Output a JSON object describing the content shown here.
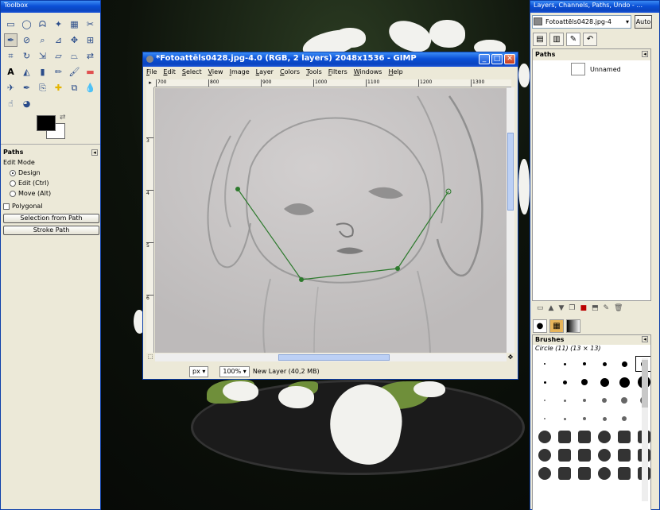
{
  "toolbox": {
    "title": "Toolbox",
    "tool_icons": [
      "rect-select-icon",
      "ellipse-select-icon",
      "lasso-icon",
      "fuzzy-select-icon",
      "color-select-icon",
      "scissors-icon",
      "paths-icon",
      "color-picker-icon",
      "zoom-icon",
      "measure-icon",
      "move-icon",
      "align-icon",
      "crop-icon",
      "rotate-icon",
      "scale-icon",
      "shear-icon",
      "perspective-icon",
      "flip-icon",
      "text-icon",
      "bucket-fill-icon",
      "blend-icon",
      "pencil-icon",
      "paintbrush-icon",
      "eraser-icon",
      "airbrush-icon",
      "ink-icon",
      "clone-icon",
      "heal-icon",
      "perspective-clone-icon",
      "blur-icon",
      "smudge-icon",
      "dodge-burn-icon"
    ],
    "fg_color": "#000000",
    "bg_color": "#ffffff",
    "options": {
      "title": "Paths",
      "edit_mode_label": "Edit Mode",
      "modes": [
        "Design",
        "Edit (Ctrl)",
        "Move (Alt)"
      ],
      "selected_mode": "Design",
      "polygonal_label": "Polygonal",
      "selection_button": "Selection from Path",
      "stroke_button": "Stroke Path"
    }
  },
  "image_window": {
    "title": "*Fotoattēls0428.jpg-4.0 (RGB, 2 layers) 2048x1536 - GIMP",
    "menus": [
      "File",
      "Edit",
      "Select",
      "View",
      "Image",
      "Layer",
      "Colors",
      "Tools",
      "Filters",
      "Windows",
      "Help"
    ],
    "ruler_top": [
      "700",
      "800",
      "900",
      "1000",
      "1100",
      "1200",
      "1300"
    ],
    "ruler_left": [
      "3",
      "4",
      "5",
      "6"
    ],
    "unit": "px",
    "zoom": "100%",
    "status": "New Layer (40,2 MB)",
    "path_point_color": "#2d7a2d"
  },
  "dock": {
    "title": "Layers, Channels, Paths, Undo - ...",
    "image_select": "Fotoattēls0428.jpg-4",
    "auto_button": "Auto",
    "paths_title": "Paths",
    "path_name": "Unnamed",
    "brushes_title": "Brushes",
    "brush_name": "Circle (11) (13 × 13)"
  }
}
